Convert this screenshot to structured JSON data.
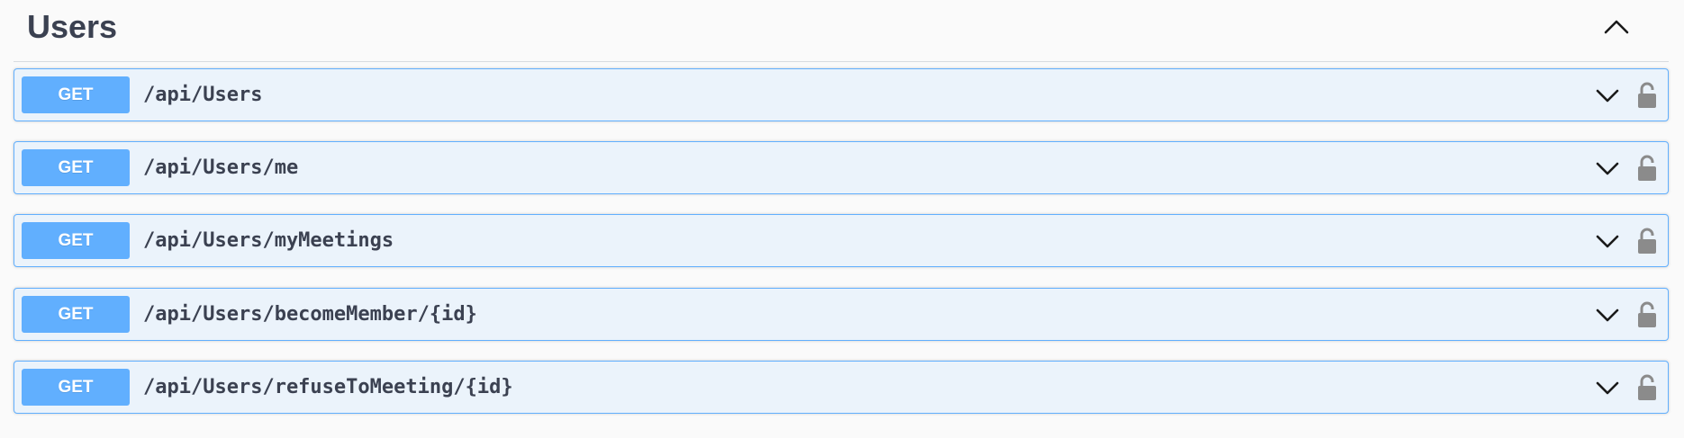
{
  "section": {
    "title": "Users",
    "collapse_icon": "chevron-up-icon"
  },
  "operations": [
    {
      "method": "GET",
      "path": "/api/Users"
    },
    {
      "method": "GET",
      "path": "/api/Users/me"
    },
    {
      "method": "GET",
      "path": "/api/Users/myMeetings"
    },
    {
      "method": "GET",
      "path": "/api/Users/becomeMember/{id}"
    },
    {
      "method": "GET",
      "path": "/api/Users/refuseToMeeting/{id}"
    }
  ],
  "icons": {
    "expand": "chevron-down-icon",
    "lock": "unlocked-padlock-icon"
  },
  "colors": {
    "get_accent": "#61affe",
    "get_background": "#ebf3fb",
    "text": "#3b4151",
    "lock": "#8b8b8b"
  }
}
